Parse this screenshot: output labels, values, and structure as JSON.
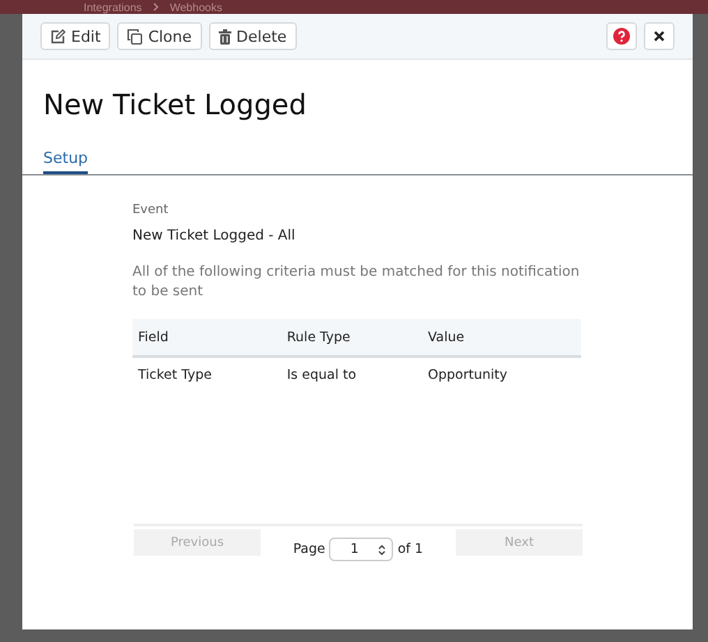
{
  "background": {
    "breadcrumb": [
      "Integrations",
      "Webhooks"
    ]
  },
  "toolbar": {
    "buttons": [
      {
        "kind": "edit",
        "label": "Edit"
      },
      {
        "kind": "clone",
        "label": "Clone"
      },
      {
        "kind": "delete",
        "label": "Delete"
      }
    ]
  },
  "title": "New Ticket Logged",
  "tabs": [
    {
      "label": "Setup",
      "selected": true
    }
  ],
  "event": {
    "label": "Event",
    "value": "New Ticket Logged - All"
  },
  "description": "All of the following criteria must be matched for this notification to be sent",
  "table": {
    "columns": [
      "Field",
      "Rule Type",
      "Value"
    ],
    "rows": [
      [
        "Ticket Type",
        "Is equal to",
        "Opportunity"
      ]
    ]
  },
  "pagination": {
    "previous": {
      "label": "Previous",
      "disabled": true
    },
    "page_label": "Page",
    "page": "1",
    "of": "of 1",
    "next": {
      "label": "Next",
      "disabled": true
    }
  }
}
